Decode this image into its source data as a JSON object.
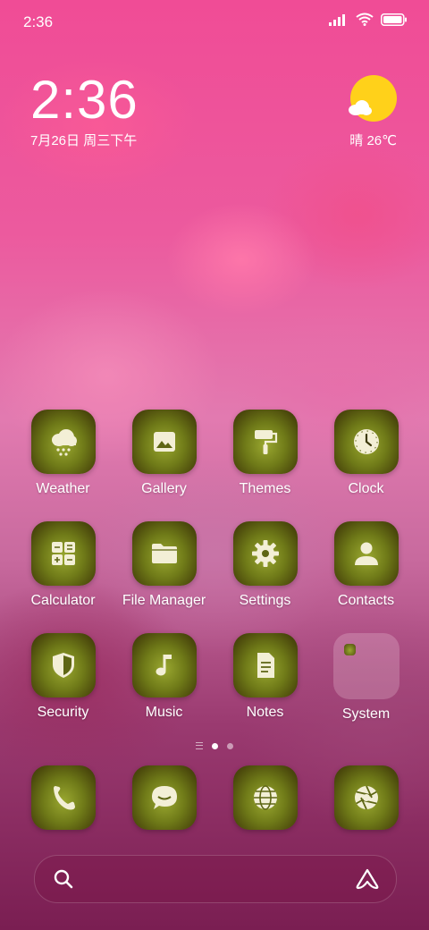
{
  "status_bar": {
    "time": "2:36"
  },
  "clock_widget": {
    "time": "2:36",
    "date": "7月26日 周三下午"
  },
  "weather_widget": {
    "text": "晴 26℃",
    "icon": "sun-cloud-icon"
  },
  "apps": [
    [
      {
        "label": "Weather",
        "icon": "weather-icon"
      },
      {
        "label": "Gallery",
        "icon": "gallery-icon"
      },
      {
        "label": "Themes",
        "icon": "themes-icon"
      },
      {
        "label": "Clock",
        "icon": "clock-icon"
      }
    ],
    [
      {
        "label": "Calculator",
        "icon": "calculator-icon"
      },
      {
        "label": "File Manager",
        "icon": "folder-icon"
      },
      {
        "label": "Settings",
        "icon": "gear-icon"
      },
      {
        "label": "Contacts",
        "icon": "person-icon"
      }
    ],
    [
      {
        "label": "Security",
        "icon": "shield-icon"
      },
      {
        "label": "Music",
        "icon": "music-icon"
      },
      {
        "label": "Notes",
        "icon": "notes-icon"
      },
      {
        "label": "System",
        "icon": "folder-group"
      }
    ]
  ],
  "dock": [
    {
      "icon": "phone-icon"
    },
    {
      "icon": "messages-icon"
    },
    {
      "icon": "browser-icon"
    },
    {
      "icon": "camera-icon"
    }
  ],
  "page_indicator": {
    "pages": 2,
    "current": 1
  },
  "colors": {
    "icon_tile": "#6f7a18",
    "glyph": "#f3efd6",
    "sun": "#ffd11a"
  }
}
